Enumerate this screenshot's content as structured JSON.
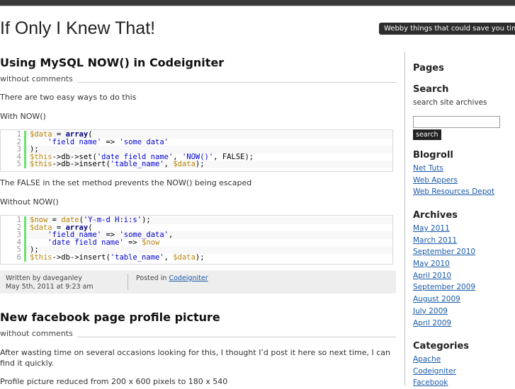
{
  "site": {
    "title": "If Only I Knew That!",
    "tagline": "Webby things that could save you time"
  },
  "posts": [
    {
      "title": "Using MySQL NOW() in Codeigniter",
      "comments": "without comments",
      "intro": "There are two easy ways to do this",
      "with_label": "With NOW()",
      "code1": [
        {
          "num": "1",
          "parts": [
            [
              "v",
              "$data"
            ],
            [
              "",
              " = "
            ],
            [
              "k",
              "array"
            ],
            [
              "",
              "("
            ]
          ]
        },
        {
          "num": "2",
          "parts": [
            [
              "",
              "    "
            ],
            [
              "s",
              "'field_name'"
            ],
            [
              "",
              " => "
            ],
            [
              "s",
              "'some_data'"
            ]
          ]
        },
        {
          "num": "3",
          "parts": [
            [
              "",
              ");"
            ]
          ]
        },
        {
          "num": "4",
          "parts": [
            [
              "v",
              "$this"
            ],
            [
              "",
              "->db->set("
            ],
            [
              "s",
              "'date_field_name'"
            ],
            [
              "",
              ", "
            ],
            [
              "s",
              "'NOW()'"
            ],
            [
              "",
              ", FALSE);"
            ]
          ]
        },
        {
          "num": "5",
          "parts": [
            [
              "v",
              "$this"
            ],
            [
              "",
              "->db->insert("
            ],
            [
              "s",
              "'table_name'"
            ],
            [
              "",
              ", "
            ],
            [
              "v",
              "$data"
            ],
            [
              "",
              ");"
            ]
          ]
        }
      ],
      "note": "The FALSE in the set method prevents the NOW() being escaped",
      "without_label": "Without NOW()",
      "code2": [
        {
          "num": "1",
          "parts": [
            [
              "v",
              "$now"
            ],
            [
              "",
              " = "
            ],
            [
              "v",
              "date"
            ],
            [
              "",
              "("
            ],
            [
              "s",
              "'Y-m-d H:i:s'"
            ],
            [
              "",
              ");"
            ]
          ]
        },
        {
          "num": "2",
          "parts": [
            [
              "v",
              "$data"
            ],
            [
              "",
              " = "
            ],
            [
              "k",
              "array"
            ],
            [
              "",
              "("
            ]
          ]
        },
        {
          "num": "3",
          "parts": [
            [
              "",
              "    "
            ],
            [
              "s",
              "'field_name'"
            ],
            [
              "",
              " => "
            ],
            [
              "s",
              "'some_data'"
            ],
            [
              "",
              ","
            ]
          ]
        },
        {
          "num": "4",
          "parts": [
            [
              "",
              "    "
            ],
            [
              "s",
              "'date_field_name'"
            ],
            [
              "",
              " => "
            ],
            [
              "v",
              "$now"
            ]
          ]
        },
        {
          "num": "5",
          "parts": [
            [
              "",
              ");"
            ]
          ]
        },
        {
          "num": "6",
          "parts": [
            [
              "v",
              "$this"
            ],
            [
              "",
              "->db->insert("
            ],
            [
              "s",
              "'table_name'"
            ],
            [
              "",
              ", "
            ],
            [
              "v",
              "$data"
            ],
            [
              "",
              ");"
            ]
          ]
        }
      ],
      "meta": {
        "author": "Written by daveganley",
        "date": "May 5th, 2011 at 9:23 am",
        "posted_in": "Posted in",
        "category": "Codeigniter"
      }
    },
    {
      "title": "New facebook page profile picture",
      "comments": "without comments",
      "para1": "After wasting time on several occasions looking for this, I thought I’d post it here so next time, I can find it quickly.",
      "para2": "Profile picture reduced from 200 x 600 pixels to 180 x 540"
    }
  ],
  "sidebar": {
    "pages_title": "Pages",
    "search_title": "Search",
    "search_desc": "search site archives",
    "search_value": "",
    "search_button": "search",
    "blogroll_title": "Blogroll",
    "blogroll": [
      "Net Tuts",
      "Web Appers",
      "Web Resources Depot"
    ],
    "archives_title": "Archives",
    "archives": [
      "May 2011",
      "March 2011",
      "September 2010",
      "May 2010",
      "April 2010",
      "September 2009",
      "August 2009",
      "July 2009",
      "April 2009"
    ],
    "categories_title": "Categories",
    "categories": [
      "Apache",
      "Codeigniter",
      "Facebook"
    ]
  }
}
